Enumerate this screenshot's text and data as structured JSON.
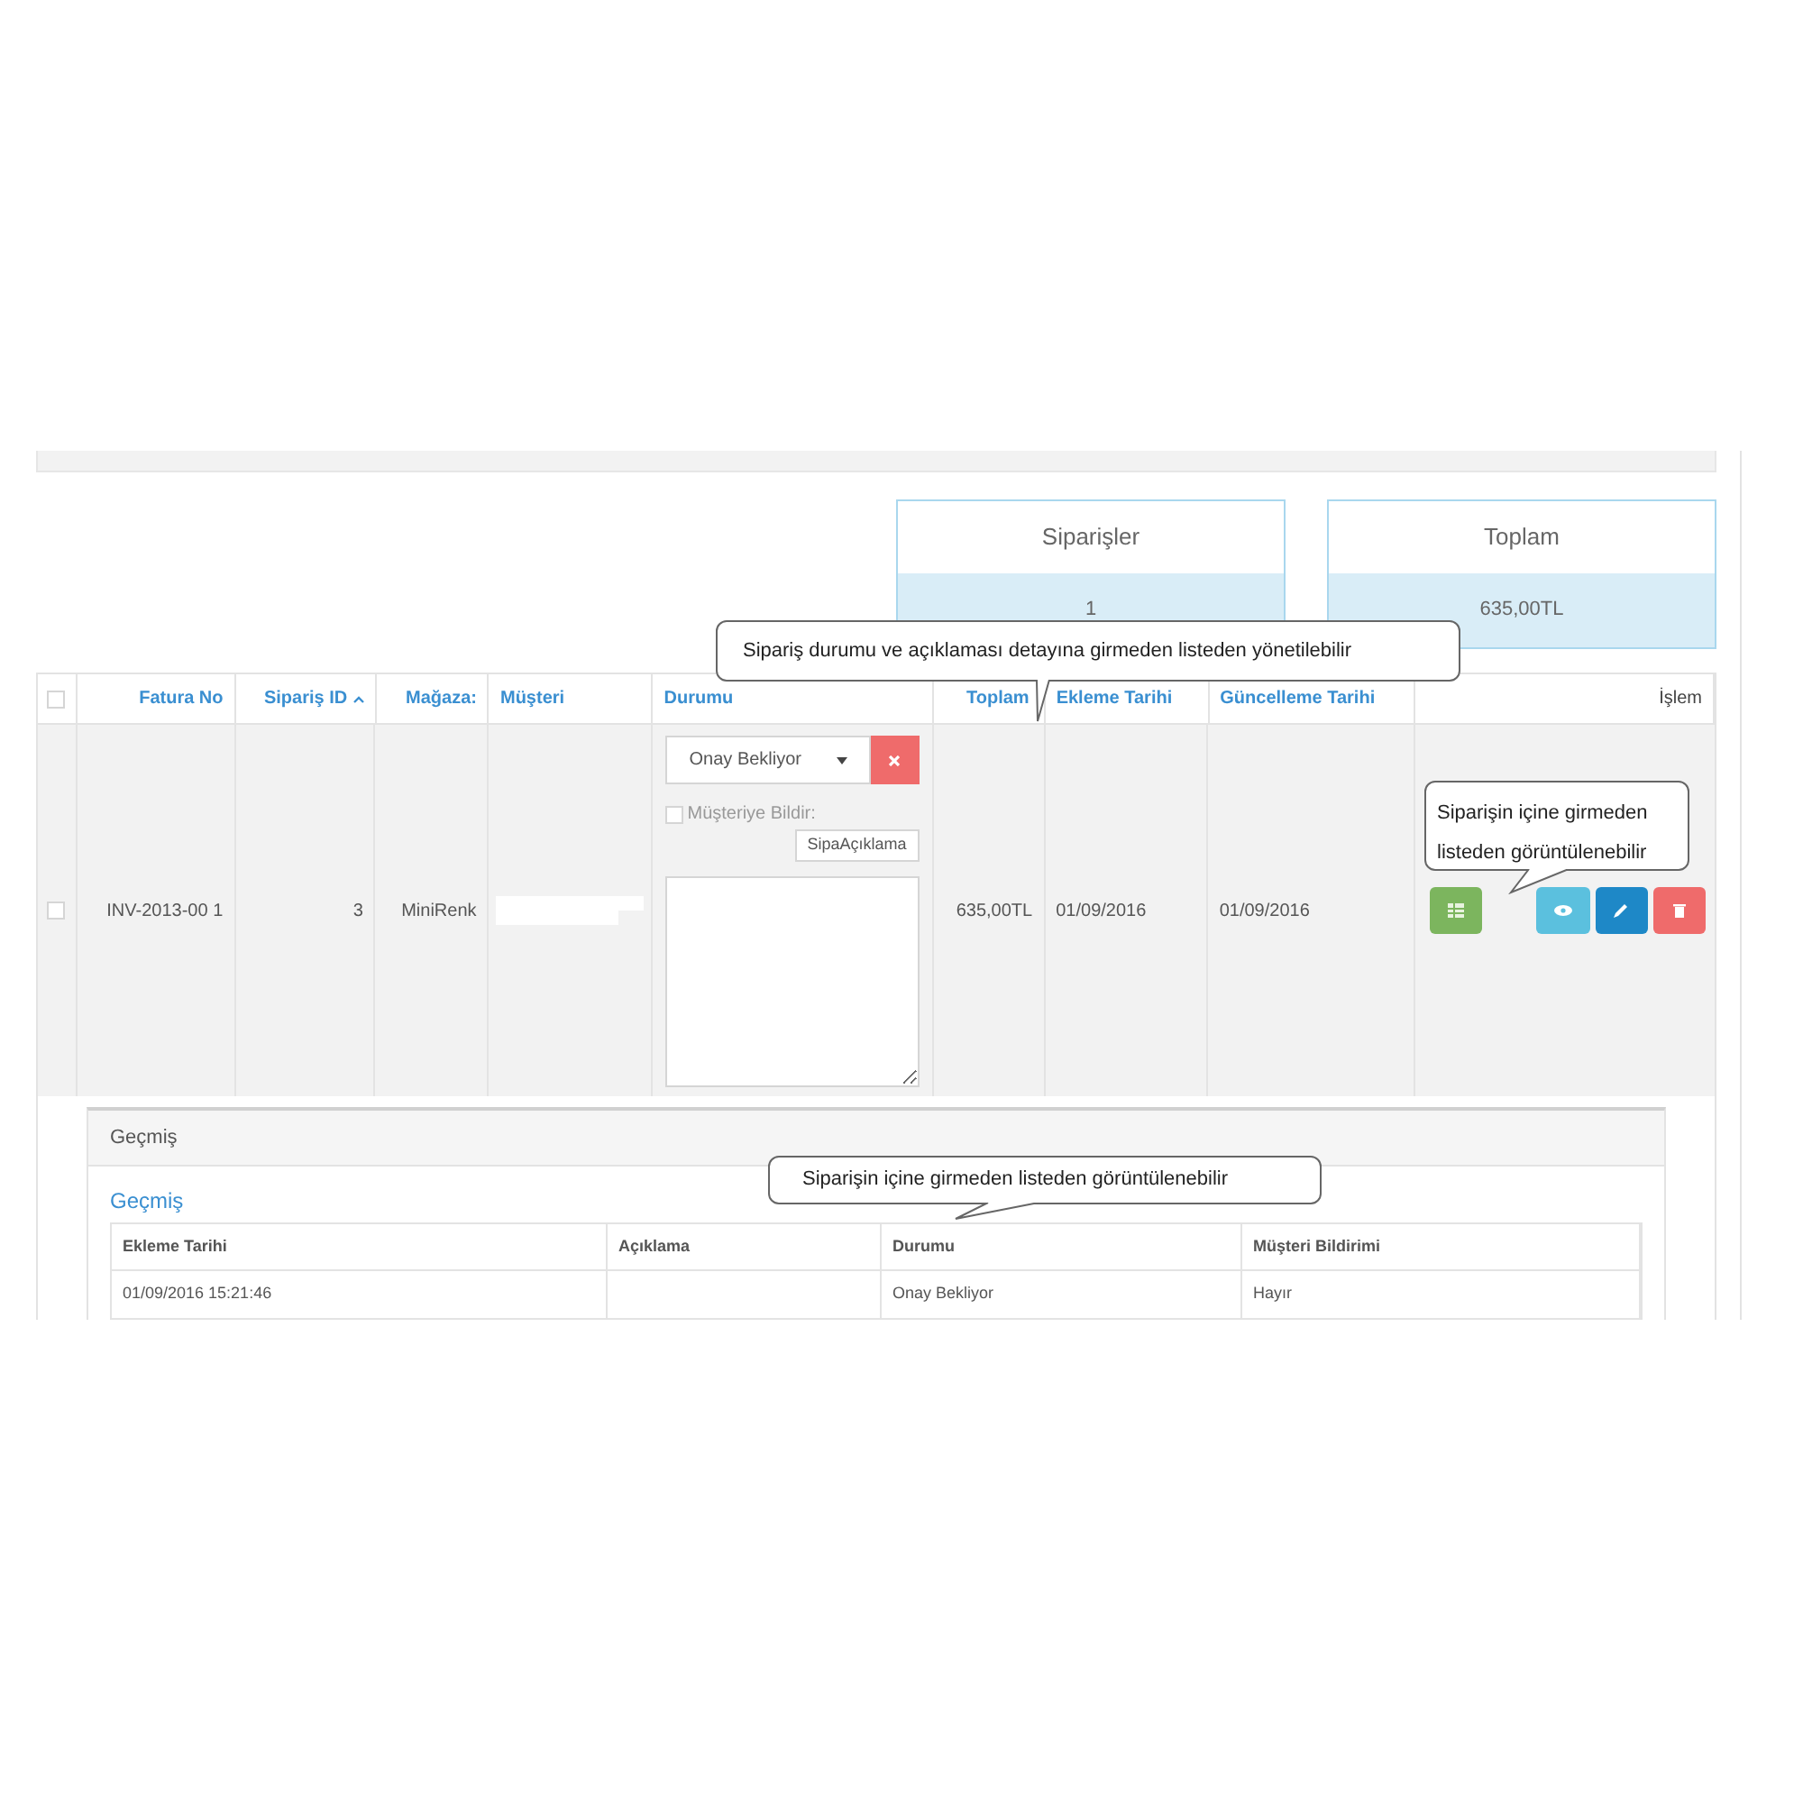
{
  "summary_cards": [
    {
      "title": "Siparişler",
      "value": "1"
    },
    {
      "title": "Toplam",
      "value": "635,00TL"
    }
  ],
  "orders_table": {
    "select_all_checked": false,
    "columns": [
      {
        "label": "Fatura No",
        "kind": "link",
        "sorted": false
      },
      {
        "label": "Sipariş ID",
        "kind": "link",
        "sorted": true
      },
      {
        "label": "Mağaza:",
        "kind": "link",
        "sorted": false
      },
      {
        "label": "Müşteri",
        "kind": "link",
        "sorted": false
      },
      {
        "label": "Durumu",
        "kind": "link",
        "sorted": false
      },
      {
        "label": "Toplam",
        "kind": "link",
        "sorted": false
      },
      {
        "label": "Ekleme Tarihi",
        "kind": "link",
        "sorted": false
      },
      {
        "label": "Güncelleme Tarihi",
        "kind": "link",
        "sorted": false
      },
      {
        "label": "İşlem",
        "kind": "text",
        "sorted": false
      }
    ],
    "rows": [
      {
        "checked": false,
        "invoice_no": "INV-2013-00 1",
        "order_id": "3",
        "store": "MiniRenk",
        "status": {
          "value": "Onay Bekliyor",
          "notify_label": "Müşteriye Bildir:",
          "notify_checked": false,
          "note_button": "SipaAçıklama"
        },
        "total": "635,00TL",
        "added": "01/09/2016",
        "updated": "01/09/2016",
        "actions": [
          {
            "kind": "list"
          },
          {
            "kind": "view"
          },
          {
            "kind": "edit"
          },
          {
            "kind": "delete"
          }
        ]
      }
    ]
  },
  "history": {
    "panel_title": "Geçmiş",
    "link": "Geçmiş",
    "columns": [
      "Ekleme Tarihi",
      "Açıklama",
      "Durumu",
      "Müşteri Bildirimi"
    ],
    "rows": [
      [
        "01/09/2016 15:21:46",
        "",
        "Onay Bekliyor",
        "Hayır"
      ]
    ]
  },
  "callouts": [
    "Sipariş durumu ve açıklaması  detayına girmeden listeden yönetilebilir",
    "Siparişin içine girmeden listeden görüntülenebilir",
    "Siparişin içine girmeden  listeden görüntülenebilir"
  ]
}
